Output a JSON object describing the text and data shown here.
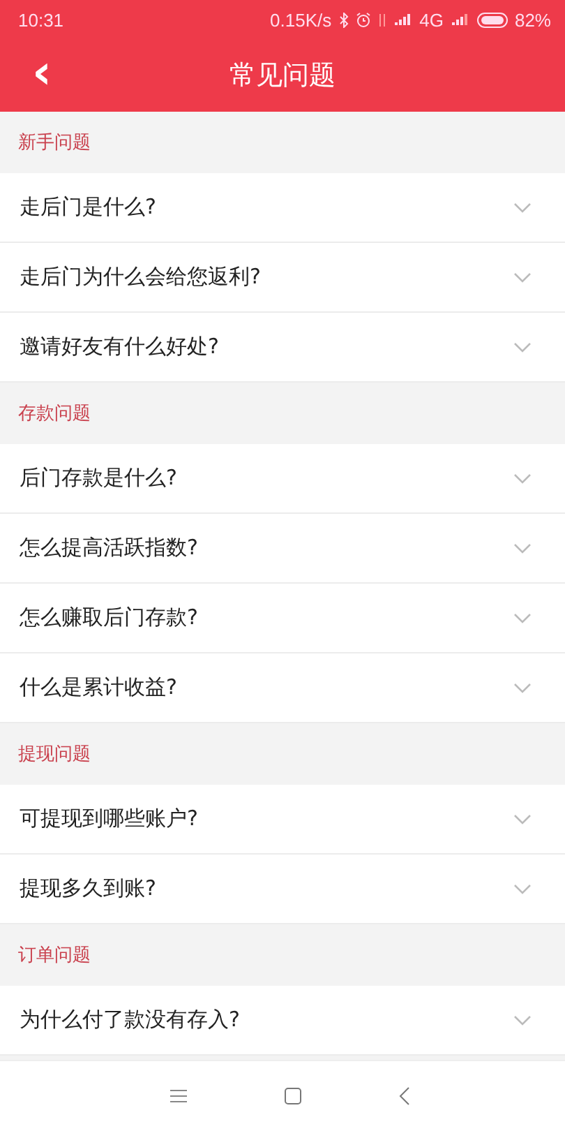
{
  "status_bar": {
    "time": "10:31",
    "network_speed": "0.15K/s",
    "network_type": "4G",
    "battery": "82%"
  },
  "header": {
    "title": "常见问题",
    "back_icon": "‹"
  },
  "sections": [
    {
      "title": "新手问题",
      "questions": [
        "走后门是什么?",
        "走后门为什么会给您返利?",
        "邀请好友有什么好处?"
      ]
    },
    {
      "title": "存款问题",
      "questions": [
        "后门存款是什么?",
        "怎么提高活跃指数?",
        "怎么赚取后门存款?",
        "什么是累计收益?"
      ]
    },
    {
      "title": "提现问题",
      "questions": [
        "可提现到哪些账户?",
        "提现多久到账?"
      ]
    },
    {
      "title": "订单问题",
      "questions": [
        "为什么付了款没有存入?"
      ]
    }
  ]
}
